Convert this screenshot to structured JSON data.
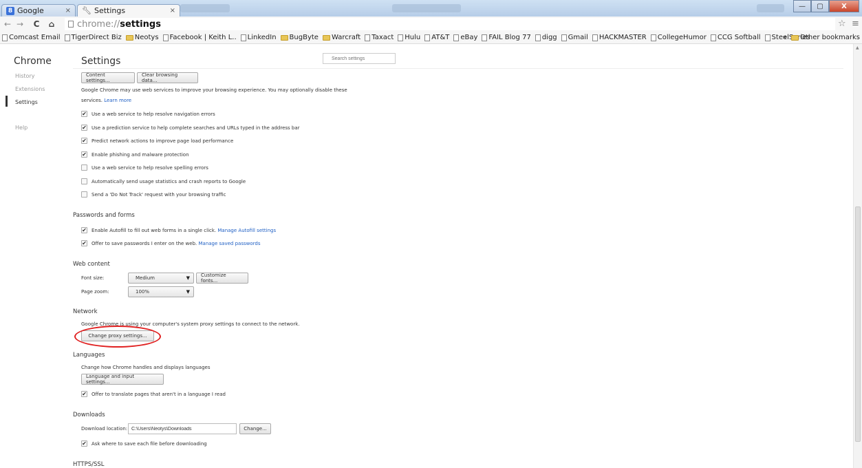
{
  "window": {
    "tabs": [
      {
        "label": "Google",
        "favicon": "google-favicon",
        "close": "×",
        "active": false
      },
      {
        "label": "Settings",
        "favicon": "wrench-icon",
        "close": "×",
        "active": true
      }
    ],
    "controls": {
      "minimize": "—",
      "maximize": "▢",
      "close": "X"
    }
  },
  "toolbar": {
    "back": "←",
    "forward": "→",
    "reload": "C",
    "home": "⌂",
    "url_scheme": "chrome://",
    "url_host": "settings",
    "star": "☆",
    "menu": "≡"
  },
  "bookmarks": {
    "items": [
      {
        "label": "Comcast Email",
        "type": "page"
      },
      {
        "label": "TigerDirect Biz",
        "type": "page"
      },
      {
        "label": "Neotys",
        "type": "folder"
      },
      {
        "label": "Facebook | Keith L..",
        "type": "page"
      },
      {
        "label": "LinkedIn",
        "type": "page"
      },
      {
        "label": "BugByte",
        "type": "folder"
      },
      {
        "label": "Warcraft",
        "type": "folder"
      },
      {
        "label": "Taxact",
        "type": "page"
      },
      {
        "label": "Hulu",
        "type": "page"
      },
      {
        "label": "AT&T",
        "type": "page"
      },
      {
        "label": "eBay",
        "type": "page"
      },
      {
        "label": "FAIL Blog 77",
        "type": "page"
      },
      {
        "label": "digg",
        "type": "page"
      },
      {
        "label": "Gmail",
        "type": "page"
      },
      {
        "label": "HACKMASTER",
        "type": "page"
      },
      {
        "label": "CollegeHumor",
        "type": "page"
      },
      {
        "label": "CCG Softball",
        "type": "page"
      },
      {
        "label": "SteelSeries",
        "type": "page"
      }
    ],
    "overflow": "»",
    "other": "Other bookmarks"
  },
  "sidebar": {
    "title": "Chrome",
    "items": [
      "History",
      "Extensions",
      "Settings",
      "Help"
    ]
  },
  "main": {
    "title": "Settings",
    "search_placeholder": "Search settings",
    "privacy": {
      "content_settings_button": "Content settings...",
      "clear_data_button": "Clear browsing data...",
      "description_line1": "Google Chrome may use web services to improve your browsing experience. You may optionally disable these",
      "description_line2": "services.",
      "learn_more": "Learn more",
      "checkboxes": [
        {
          "label": "Use a web service to help resolve navigation errors",
          "checked": "✔"
        },
        {
          "label": "Use a prediction service to help complete searches and URLs typed in the address bar",
          "checked": "✔"
        },
        {
          "label": "Predict network actions to improve page load performance",
          "checked": "✔"
        },
        {
          "label": "Enable phishing and malware protection",
          "checked": "✔"
        },
        {
          "label": "Use a web service to help resolve spelling errors",
          "checked": ""
        },
        {
          "label": "Automatically send usage statistics and crash reports to Google",
          "checked": ""
        },
        {
          "label": "Send a 'Do Not Track' request with your browsing traffic",
          "checked": ""
        }
      ]
    },
    "passwords": {
      "title": "Passwords and forms",
      "autofill_label": "Enable Autofill to fill out web forms in a single click.",
      "autofill_link": "Manage Autofill settings",
      "passwords_label": "Offer to save passwords I enter on the web.",
      "passwords_link": "Manage saved passwords",
      "check": "✔"
    },
    "web_content": {
      "title": "Web content",
      "font_size_label": "Font size:",
      "font_size_value": "Medium",
      "customize_fonts_button": "Customize fonts...",
      "page_zoom_label": "Page zoom:",
      "page_zoom_value": "100%",
      "arrow": "▼"
    },
    "network": {
      "title": "Network",
      "description": "Google Chrome is using your computer's system proxy settings to connect to the network.",
      "proxy_button": "Change proxy settings..."
    },
    "languages": {
      "title": "Languages",
      "description": "Change how Chrome handles and displays languages",
      "button": "Language and input settings...",
      "translate_label": "Offer to translate pages that aren't in a language I read",
      "check": "✔"
    },
    "downloads": {
      "title": "Downloads",
      "location_label": "Download location:",
      "location_value": "C:\\Users\\Neotys\\Downloads",
      "change_button": "Change...",
      "ask_label": "Ask where to save each file before downloading",
      "check": "✔"
    },
    "https": {
      "title": "HTTPS/SSL"
    }
  }
}
